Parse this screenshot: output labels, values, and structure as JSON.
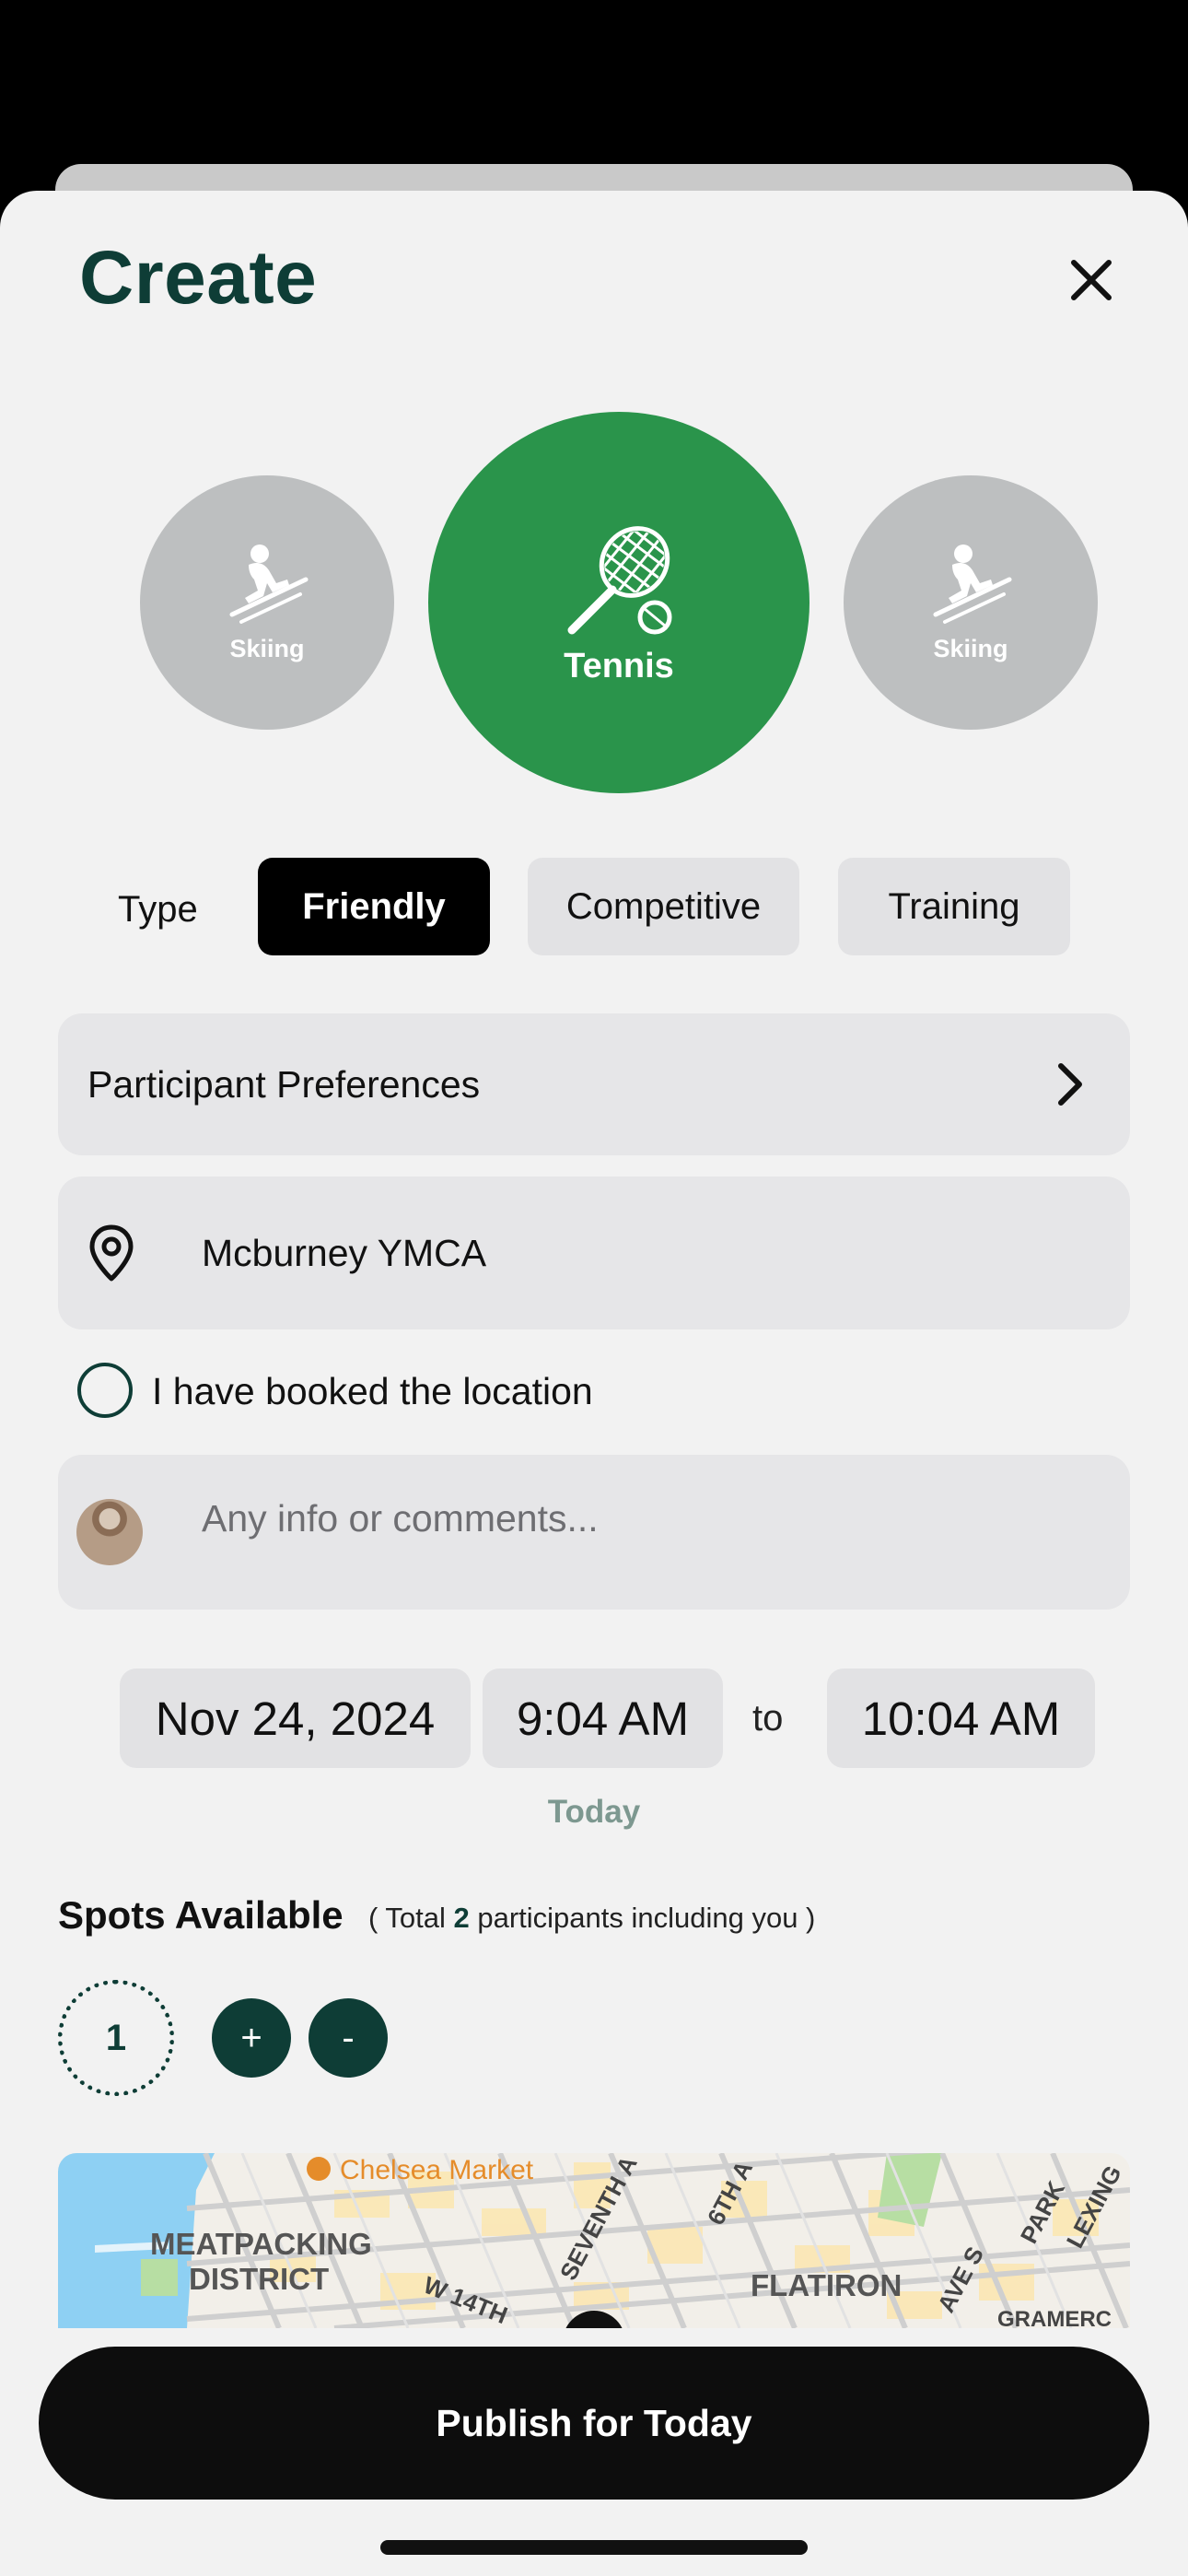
{
  "sheet": {
    "title": "Create"
  },
  "sports": [
    {
      "label": "Skiing",
      "icon": "skier-icon"
    },
    {
      "label": "Tennis",
      "icon": "tennis-racket-icon"
    },
    {
      "label": "Skiing",
      "icon": "skier-icon"
    }
  ],
  "type": {
    "label": "Type",
    "options": [
      "Friendly",
      "Competitive",
      "Training"
    ],
    "selected": "Friendly"
  },
  "participant_preferences": {
    "label": "Participant Preferences"
  },
  "location": {
    "value": "Mcburney YMCA",
    "booked_label": "I have booked the location",
    "booked": false
  },
  "comments": {
    "placeholder": "Any info or comments..."
  },
  "schedule": {
    "date": "Nov 24, 2024",
    "start": "9:04 AM",
    "to": "to",
    "end": "10:04 AM",
    "relative_day": "Today"
  },
  "spots": {
    "title": "Spots Available",
    "note_prefix": "( Total ",
    "total": "2",
    "note_suffix": " participants including you )",
    "count": "1",
    "plus": "+",
    "minus": "-"
  },
  "map": {
    "labels": {
      "chelsea_market": "Chelsea Market",
      "meatpacking": "MEATPACKING",
      "district": "DISTRICT",
      "flatiron": "FLATIRON",
      "w14th": "W 14TH",
      "seventh": "SEVENTH A",
      "sixth": "6TH A",
      "park": "PARK",
      "lexington": "LEXING",
      "ave_s": "AVE S",
      "gramercy": "GRAMERC"
    },
    "colors": {
      "water": "#8ed0f3",
      "land": "#f2efe9",
      "park": "#b7dea3",
      "block": "#fbe7b3",
      "road": "#cfcfcf"
    }
  },
  "publish": {
    "label": "Publish for Today"
  },
  "colors": {
    "brand_dark": "#0e3d36",
    "sport_active": "#2a944b",
    "sport_inactive": "#bdbfc0"
  }
}
